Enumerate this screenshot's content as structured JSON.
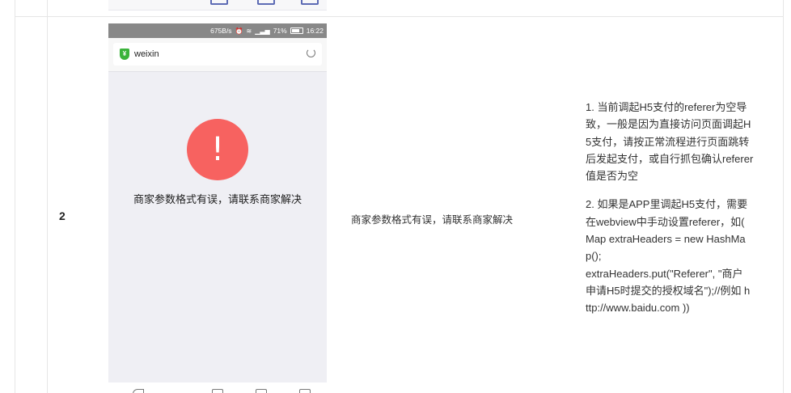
{
  "table": {
    "row": {
      "number": "2",
      "screenshot": {
        "status_bar": {
          "speed": "675B/s",
          "battery": "71%",
          "time": "16:22"
        },
        "url_title": "weixin",
        "error_message": "商家参数格式有误，请联系商家解决",
        "error_symbol": "!"
      },
      "description": "商家参数格式有误，请联系商家解决",
      "solution": [
        "1. 当前调起H5支付的referer为空导\n致，一般是因为直接访问页面调起H\n5支付，请按正常流程进行页面跳转\n后发起支付，或自行抓包确认referer\n值是否为空",
        "2. 如果是APP里调起H5支付，需要\n在webview中手动设置referer，如(\nMap extraHeaders = new HashMa\np();\nextraHeaders.put(\"Referer\", \"商户\n申请H5时提交的授权域名\");//例如 h\nttp://www.baidu.com ))"
      ]
    }
  },
  "colors": {
    "alert": "#f76260",
    "status_bar": "#888888",
    "secure": "#3bb33b"
  }
}
